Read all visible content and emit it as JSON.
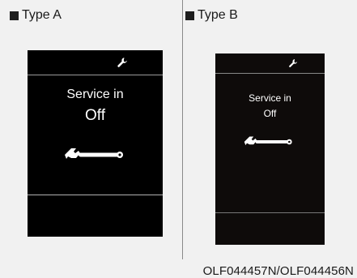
{
  "panels": [
    {
      "label": "Type A",
      "service_text": "Service in",
      "status_text": "Off",
      "icon": "wrench-icon"
    },
    {
      "label": "Type B",
      "service_text": "Service in",
      "status_text": "Off",
      "icon": "wrench-icon"
    }
  ],
  "caption": "OLF044457N/OLF044456N",
  "colors": {
    "background": "#f1f1f1",
    "screen": "#000000",
    "text_on_screen": "#ffffff"
  }
}
